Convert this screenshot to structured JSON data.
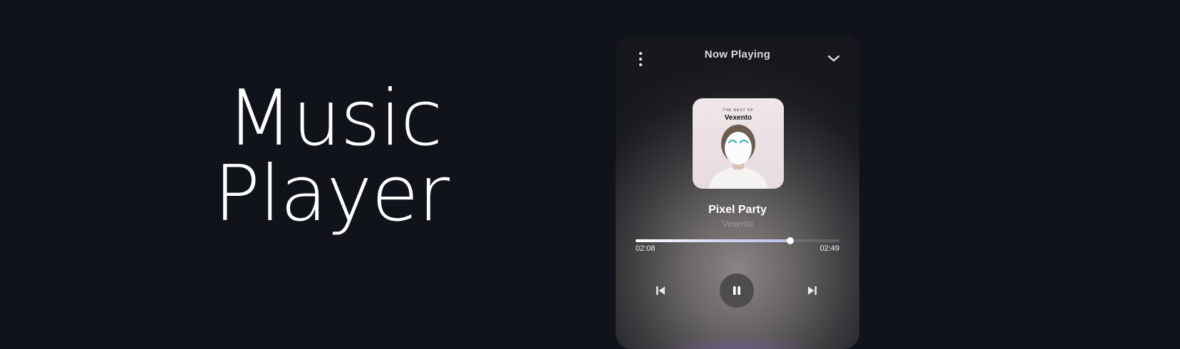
{
  "hero": {
    "line1": "Music",
    "line2": "Player"
  },
  "player": {
    "header_title": "Now Playing",
    "album_art": {
      "kicker": "THE BEST OF",
      "artist": "Vexento"
    },
    "track": {
      "title": "Pixel Party",
      "artist": "Vexento"
    },
    "progress": {
      "elapsed": "02:08",
      "total": "02:49",
      "fraction": 0.757
    },
    "icons": {
      "menu": "more-vertical-icon",
      "collapse": "chevron-down-icon",
      "previous": "skip-previous-icon",
      "play_pause": "pause-icon",
      "next": "skip-next-icon"
    },
    "colors": {
      "page_background": "#11131b",
      "progress_fill": "#c6cbf0",
      "play_button": "#4e4c4e"
    }
  }
}
